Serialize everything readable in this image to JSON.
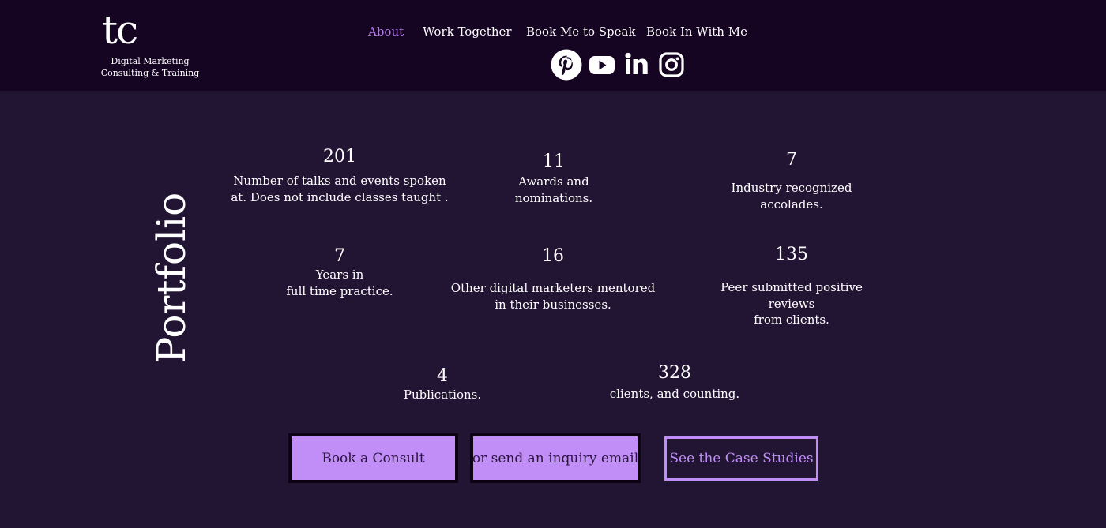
{
  "brand": {
    "mark": "tc",
    "tagline_line1": "Digital Marketing",
    "tagline_line2": "Consulting & Training"
  },
  "nav": {
    "items": [
      {
        "label": "About",
        "active": true
      },
      {
        "label": "Work Together",
        "active": false
      },
      {
        "label": "Book Me to Speak",
        "active": false
      },
      {
        "label": "Book In With Me",
        "active": false
      }
    ],
    "active_color": "#b57cf0"
  },
  "social": [
    "pinterest-icon",
    "youtube-icon",
    "linkedin-icon",
    "instagram-icon"
  ],
  "section": {
    "title": "Portfolio"
  },
  "stats": [
    {
      "value": "201",
      "desc_line1": "Number of talks and events spoken",
      "desc_line2": "at. Does not include classes taught .",
      "desc_line3": ""
    },
    {
      "value": "11",
      "desc_line1": "Awards and",
      "desc_line2": "nominations.",
      "desc_line3": ""
    },
    {
      "value": "7",
      "desc_line1": "Industry recognized",
      "desc_line2": "accolades.",
      "desc_line3": ""
    },
    {
      "value": "7",
      "desc_line1": "Years in",
      "desc_line2": "full time practice.",
      "desc_line3": ""
    },
    {
      "value": "16",
      "desc_line1": "Other digital marketers mentored",
      "desc_line2": "in their businesses.",
      "desc_line3": ""
    },
    {
      "value": "135",
      "desc_line1": "Peer submitted positive",
      "desc_line2": "reviews",
      "desc_line3": "from clients."
    },
    {
      "value": "4",
      "desc_line1": "Publications.",
      "desc_line2": "",
      "desc_line3": ""
    },
    {
      "value": "328",
      "desc_line1": "clients, and counting.",
      "desc_line2": "",
      "desc_line3": ""
    }
  ],
  "buttons": {
    "consult": "Book a Consult",
    "inquiry": "or send an inquiry email",
    "case_studies": "See the Case Studies"
  },
  "colors": {
    "header_bg": "#150422",
    "page_bg": "#221433",
    "accent": "#c08ef6"
  }
}
